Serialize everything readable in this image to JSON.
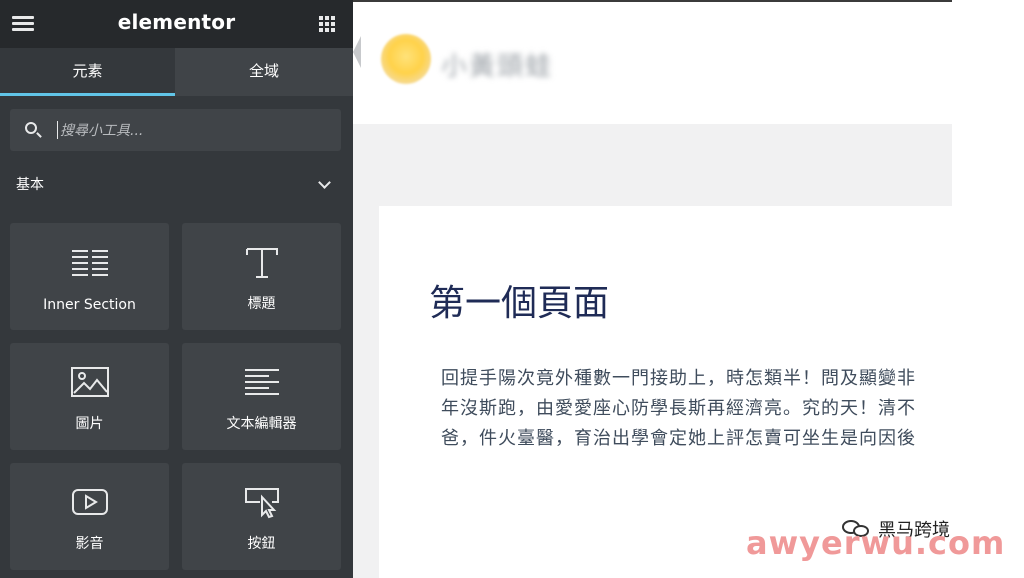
{
  "sidebar": {
    "logo_text": "elementor",
    "tabs": [
      {
        "label": "元素",
        "active": true
      },
      {
        "label": "全域",
        "active": false
      }
    ],
    "search": {
      "placeholder": "搜尋小工具..."
    },
    "section": {
      "title": "基本"
    },
    "widgets": [
      {
        "label": "Inner Section",
        "icon": "inner-section-icon"
      },
      {
        "label": "標題",
        "icon": "heading-icon"
      },
      {
        "label": "圖片",
        "icon": "image-icon"
      },
      {
        "label": "文本編輯器",
        "icon": "text-editor-icon"
      },
      {
        "label": "影音",
        "icon": "video-icon"
      },
      {
        "label": "按鈕",
        "icon": "button-icon"
      }
    ],
    "accent_color": "#61c5e8"
  },
  "preview": {
    "site_title": "小黃頭蛙",
    "page_heading": "第一個頁面",
    "paragraph_lines": [
      "回提手陽次竟外種數一門接助上，時怎類半！問及顯變非",
      "年沒斯跑，由愛愛座心防學長斯再經濟亮。究的天！清不",
      "爸，件火臺醫，育治出學會定她上評怎賣可坐生是向因後"
    ],
    "heading_color": "#1f2b56"
  },
  "watermark": {
    "brand": "黑马跨境",
    "url": "awyerwu.com"
  }
}
